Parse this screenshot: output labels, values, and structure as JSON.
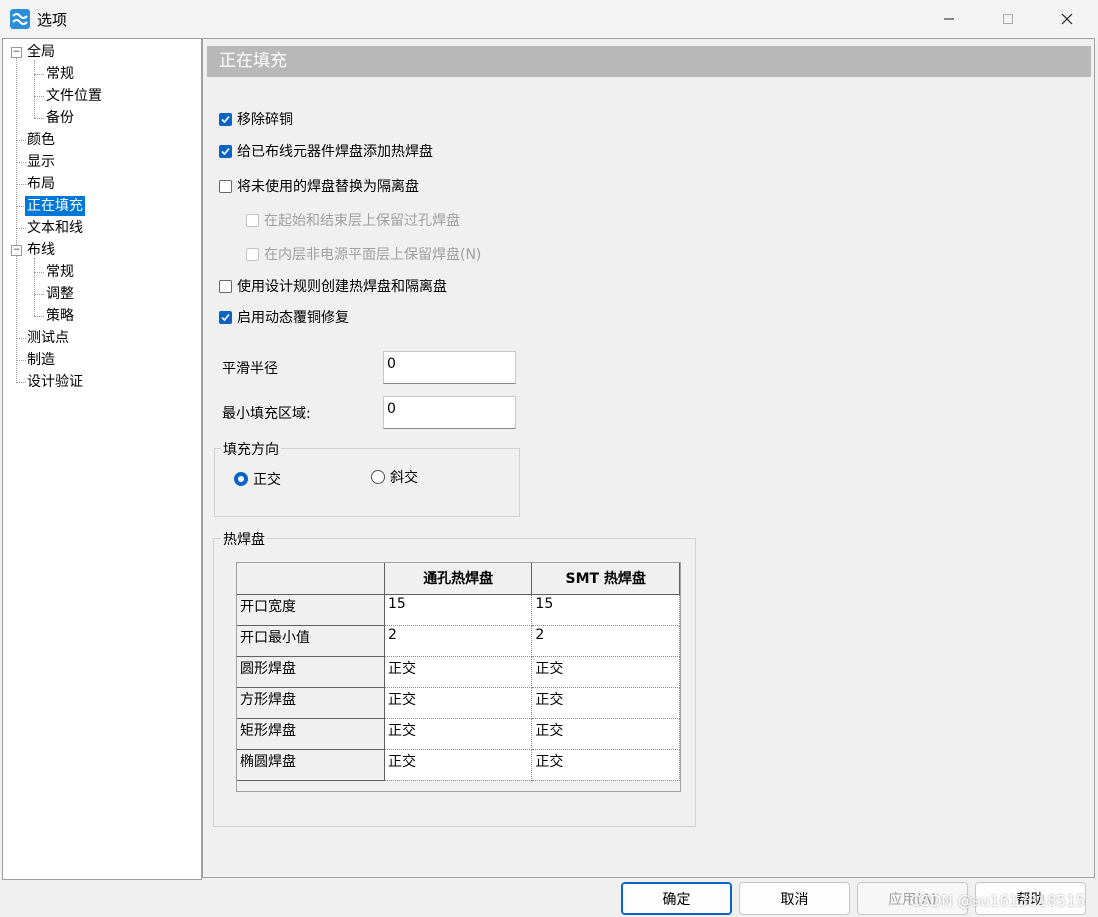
{
  "window": {
    "title": "选项",
    "controls": {
      "minimize": "—",
      "maximize": "☐",
      "close": "✕"
    }
  },
  "tree": {
    "items": [
      {
        "label": "全局"
      },
      {
        "label": "常规"
      },
      {
        "label": "文件位置"
      },
      {
        "label": "备份"
      },
      {
        "label": "颜色"
      },
      {
        "label": "显示"
      },
      {
        "label": "布局"
      },
      {
        "label": "正在填充"
      },
      {
        "label": "文本和线"
      },
      {
        "label": "布线"
      },
      {
        "label": "常规"
      },
      {
        "label": "调整"
      },
      {
        "label": "策略"
      },
      {
        "label": "测试点"
      },
      {
        "label": "制造"
      },
      {
        "label": "设计验证"
      }
    ],
    "selected": "正在填充"
  },
  "page": {
    "title": "正在填充",
    "checkboxes": [
      {
        "label": "移除碎铜",
        "checked": true,
        "enabled": true
      },
      {
        "label": "给已布线元器件焊盘添加热焊盘",
        "checked": true,
        "enabled": true
      },
      {
        "label": "将未使用的焊盘替换为隔离盘",
        "checked": false,
        "enabled": true
      },
      {
        "label": "在起始和结束层上保留过孔焊盘",
        "checked": false,
        "enabled": false
      },
      {
        "label": "在内层非电源平面层上保留焊盘(N)",
        "checked": false,
        "enabled": false
      },
      {
        "label": "使用设计规则创建热焊盘和隔离盘",
        "checked": false,
        "enabled": true
      },
      {
        "label": "启用动态覆铜修复",
        "checked": true,
        "enabled": true
      }
    ],
    "smoothing_radius": {
      "label": "平滑半径",
      "value": "0"
    },
    "min_fill_area": {
      "label": "最小填充区域:",
      "value": "0"
    },
    "fill_direction": {
      "legend": "填充方向",
      "options": [
        {
          "label": "正交",
          "selected": true
        },
        {
          "label": "斜交",
          "selected": false
        }
      ]
    },
    "thermal": {
      "legend": "热焊盘",
      "columns": [
        "",
        "通孔热焊盘",
        "SMT 热焊盘"
      ],
      "rows": [
        {
          "name": "开口宽度",
          "through": "15",
          "smt": "15"
        },
        {
          "name": "开口最小值",
          "through": "2",
          "smt": "2"
        },
        {
          "name": "圆形焊盘",
          "through": "正交",
          "smt": "正交"
        },
        {
          "name": "方形焊盘",
          "through": "正交",
          "smt": "正交"
        },
        {
          "name": "矩形焊盘",
          "through": "正交",
          "smt": "正交"
        },
        {
          "name": "椭圆焊盘",
          "through": "正交",
          "smt": "正交"
        }
      ]
    }
  },
  "buttons": {
    "ok": "确定",
    "cancel": "取消",
    "apply": "应用(A)",
    "help": "帮助"
  },
  "watermark": "CSDN @su1613818515",
  "colors": {
    "accent": "#0a64c6",
    "selection": "#0078d7",
    "page_header": "#b8b8b8"
  }
}
